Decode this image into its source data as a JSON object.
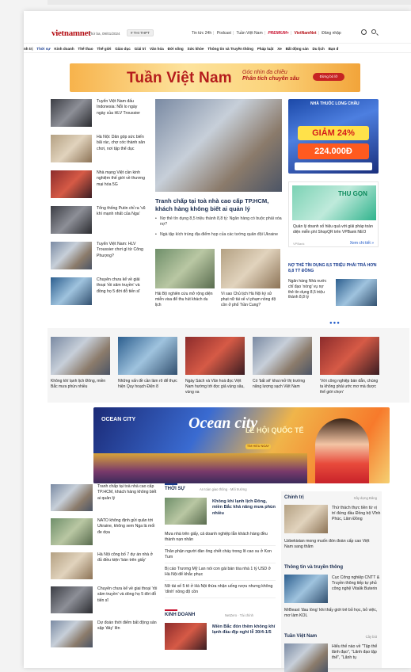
{
  "header": {
    "logo_main": "vietnamnet",
    "date": "Thứ ba, 09/01/2024",
    "exam_tag": "# THI THPT",
    "links": [
      "Tin tức 24h",
      "Podcast",
      "Tuần Việt Nam"
    ],
    "premium": "PREMIUM+",
    "logo_small": "VietNamNet",
    "login": "Đăng nhập"
  },
  "nav": [
    "nh trị",
    "Thời sự",
    "Kinh doanh",
    "Thể thao",
    "Thế giới",
    "Giáo dục",
    "Giải trí",
    "Văn hóa",
    "Đời sống",
    "Sức khỏe",
    "Thông tin và Truyền thông",
    "Pháp luật",
    "Xe",
    "Bất động sản",
    "Du lịch",
    "Bạn đ"
  ],
  "top_banner": {
    "title": "Tuần Việt Nam",
    "tagline1": "Góc nhìn đa chiều",
    "tagline2": "Phân tích chuyên sâu",
    "cta": "Đừng bỏ lỡ"
  },
  "left_col": [
    "Tuyển Việt Nam đấu Indonesia: Nỗi lo ngày ngày của HLV Troussier",
    "Hà Nội: Dân góp sức biến bãi rác, chợ cóc thành sân chơi, nơi tập thể dục",
    "Nhà mạng Việt cần kinh nghiệm thế giới về thương mại hóa 5G",
    "Tổng thống Putin chỉ ra 'vũ khí mạnh nhất của Nga'",
    "Tuyển Việt Nam: HLV Troussier chơi gì từ Công Phượng?",
    "Chuyên chưa kể về giải thoại 'rồi sâm truyền' và đồng họ 5 đời đỗ tiến sĩ"
  ],
  "featured": {
    "title": "Tranh chấp tại toà nhà cao cấp TP.HCM, khách hàng không biết ai quản lý",
    "bullets": [
      "Nợ thẻ tín dụng 8,5 triệu thành 8,8 tỷ: Ngân hàng có buộc phải xóa nợ?",
      "Ngà tập kích trúng địa điểm họp của các tướng quân đội Ukraine"
    ],
    "sub": [
      "Hải Bộ nghiên cứu mở rộng diện miễn visa để thu hút khách du lịch",
      "Vì sao Chủ tịch Hà Nội ký xử phạt nữ tài xế vì phạm nồng độ cồn ở phố Trần Cung?"
    ]
  },
  "ad_pharmacy": {
    "brand": "NHÀ THUỐC LONG CHÂU",
    "offer1": "GIẢM 24%",
    "offer2": "224.000Đ"
  },
  "ad_bank": {
    "img_text": "THU GỌN",
    "text": "Quản lý doanh số hiệu quả với giải pháp toàn diện miễn phí ShopQR trên VPBank NEO",
    "sponsor": "VPBank",
    "more": "Xem chi tiết »"
  },
  "credit_story": {
    "heading": "NỢ THẺ TÍN DỤNG 8,5 TRIỆU PHẢI TRẢ HƠN 8,8 TỶ ĐỒNG",
    "text": "Ngân hàng Nhà nước chỉ đạo 'nóng' vụ nợ thẻ tín dụng 8,5 triệu thành 8,8 tỷ"
  },
  "band": [
    "Không khí lạnh lịch Đông, miền Bắc mưa phùn nhiều",
    "Những vấn đề cần làm rõ để thực hiện Quy hoạch Điện 8",
    "Ngày Sách và Văn hoá đọc Việt Nam hướng tới đọc giả vùng sâu, vùng xa",
    "Có 'bất sẽ' khai mở thị trường năng lượng sạch Việt Nam",
    "'Với công nghiệp bán dẫn, chúng ta không phải ước mơ mà được thể giới chọn'"
  ],
  "ad_ocean": {
    "brand": "OCEAN CITY",
    "title": "Ocean city",
    "sub": "LỄ HỘI QUỐC TẾ",
    "cta": "TÌM HIỂU NGAY"
  },
  "bottom_left": [
    "Tranh chấp tại toà nhà cao cấp TP.HCM, khách hàng không biết ai quản lý",
    "NATO không định gửi quân tới Ukraine, không xem Nga là mối đe dọa",
    "Hà Nội công bố 7 dự án nhà ở đủ điều kiện 'bán trên giấy'",
    "Chuyên chưa kể về giai thoại 'rồi sâm truyền' và dòng họ 5 đời đỗ tiến sĩ",
    "Dự đoán thời điểm bất động sản sập 'đáy' lên"
  ],
  "thoi_su": {
    "title": "THỜI SỰ",
    "sub": "An toàn giao thông · Môi trường",
    "top": "Không khí lạnh lịch Đông, miền Bắc khả năng mưa phùn nhiều",
    "lines": [
      "Mưa nhà trên giấy, cả doanh nghiệp lẫn khách hàng đều thành nạn nhân",
      "Thân phận người đàn ông chết cháy trong lô cao su ở Kon Tum",
      "Bị cáo Trương Mỹ Lan nói con gái bán tòa nhà 1 tỷ USD ở Hà Nội để khắc phục",
      "Nữ tài xế 5 tô ở Hà Nội thừa nhận uống rượu nhưng không 'dính' nồng độ cồn"
    ]
  },
  "kinh_doanh": {
    "title": "KINH DOANH",
    "sub": "NetZero · Tài chính",
    "top": "Miền Bắc đón thêm không khí lạnh đầu địp nghỉ lễ 30/4-1/5"
  },
  "chinh_tri": {
    "title": "Chính trị",
    "sub": "Xây dựng Đảng",
    "top": "Thứ thách thực tiền từ vị trí đứng đầu Đồng bộ Vĩnh Phúc, Lâm Đồng",
    "line": "Uzbekistan mong muốn đón đoàn cấp cao Việt Nam sang thăm"
  },
  "ttt": {
    "title": "Thông tin và truyền thông",
    "top": "Cục Công nghiệp CNTT & Truyền thông tiếp tự phủ công nghệ Vitalik Buterin",
    "line": "MrBeast 'đau lòng' khi thấy giới trẻ bỏ học, bỏ việc, mơ làm KOL"
  },
  "tvn": {
    "title": "Tuần Việt Nam",
    "sub": "Cây bút",
    "top": "Hiểu thế nào về \"Tập thể lãnh đạo\", \"Lãnh đạo tập thể\", \"Lãnh tụ"
  }
}
